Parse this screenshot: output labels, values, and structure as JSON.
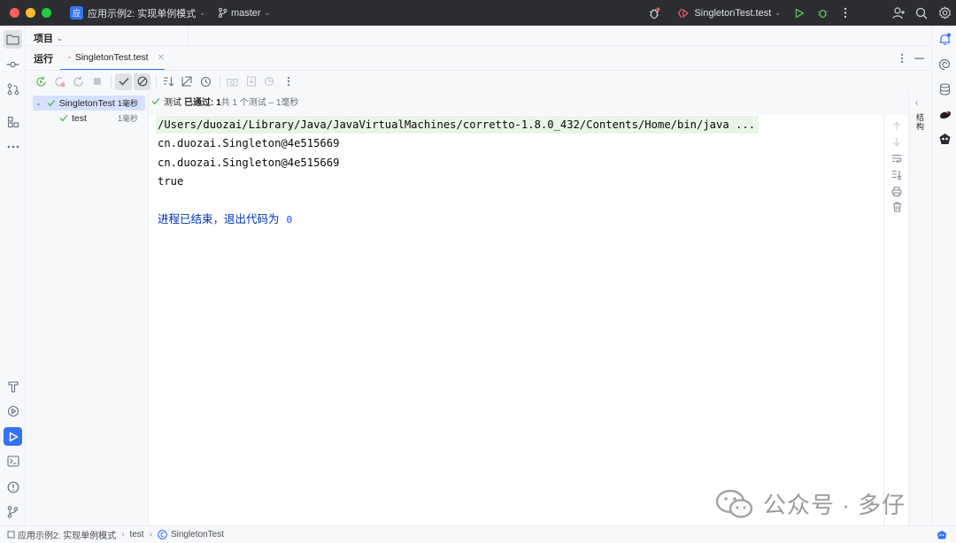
{
  "titlebar": {
    "project_badge": "应",
    "project_name": "应用示例2: 实现单例模式",
    "branch": "master",
    "run_config": "SingletonTest.test",
    "colors": {
      "background": "#2b2d30",
      "accent": "#3574f0"
    }
  },
  "project_panel": {
    "label": "项目"
  },
  "run_panel": {
    "label": "运行",
    "tab": {
      "label": "SingletonTest.test"
    }
  },
  "test_tree": [
    {
      "label": "SingletonTest",
      "time": "1毫秒",
      "status": "passed"
    },
    {
      "label": "test",
      "time": "1毫秒",
      "status": "passed"
    }
  ],
  "test_status": {
    "prefix": "测试",
    "passed": "已通过: 1",
    "detail": "共 1 个测试 – 1毫秒"
  },
  "console": {
    "lines": [
      "/Users/duozai/Library/Java/JavaVirtualMachines/corretto-1.8.0_432/Contents/Home/bin/java ...",
      "cn.duozai.Singleton@4e515669",
      "cn.duozai.Singleton@4e515669",
      "true"
    ],
    "exit_message": "进程已结束，退出代码为",
    "exit_code": "0"
  },
  "side_panel": {
    "label": "结构"
  },
  "watermark": {
    "text": "公众号 · 多仔"
  },
  "statusbar": {
    "crumbs": [
      "应用示例2: 实现单例模式",
      "test",
      "SingletonTest"
    ]
  }
}
